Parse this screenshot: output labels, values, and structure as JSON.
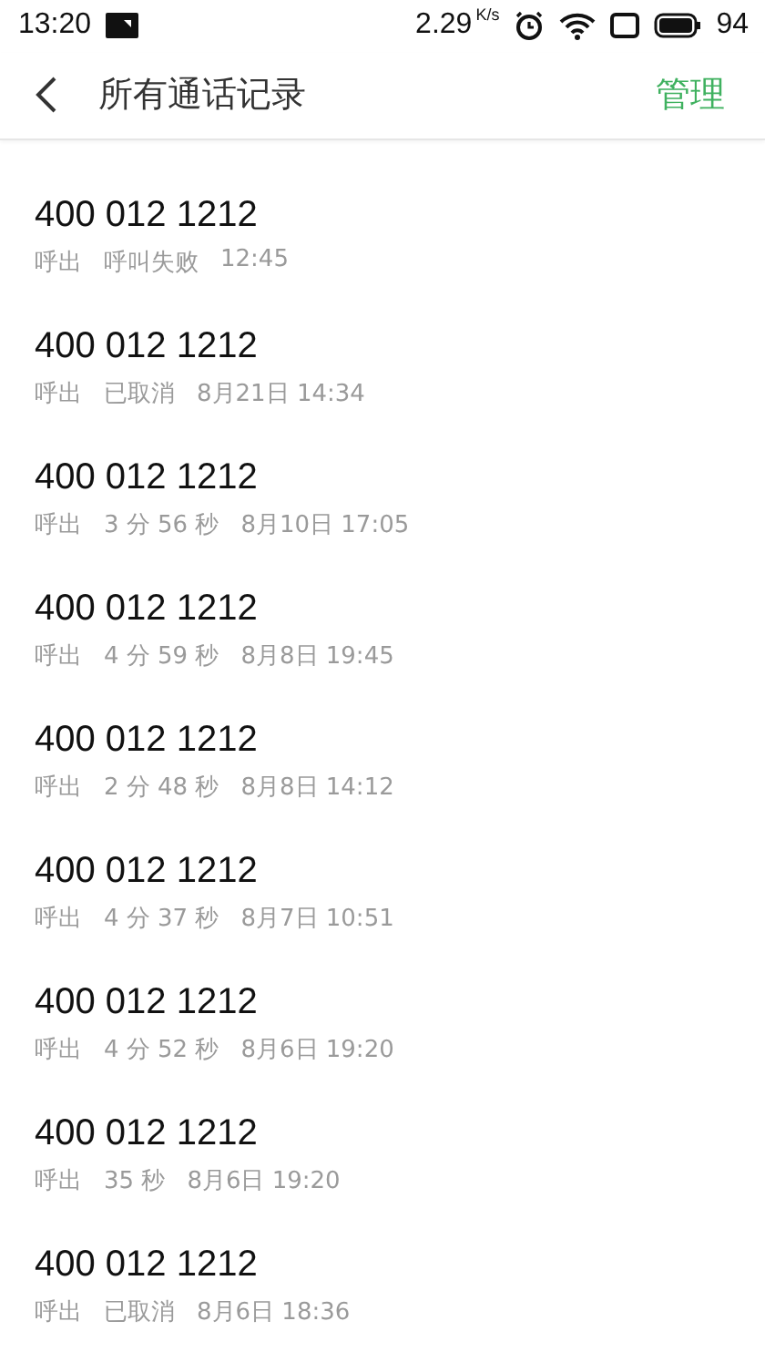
{
  "status_bar": {
    "time": "13:20",
    "speed": "2.29",
    "speed_unit": "K/s",
    "battery": "94"
  },
  "header": {
    "title": "所有通话记录",
    "action": "管理"
  },
  "calls": [
    {
      "number": "400 012 1212",
      "type": "呼出",
      "result": "呼叫失败",
      "time": "12:45"
    },
    {
      "number": "400 012 1212",
      "type": "呼出",
      "result": "已取消",
      "time": "8月21日 14:34"
    },
    {
      "number": "400 012 1212",
      "type": "呼出",
      "result": "3 分 56 秒",
      "time": "8月10日 17:05"
    },
    {
      "number": "400 012 1212",
      "type": "呼出",
      "result": "4 分 59 秒",
      "time": "8月8日 19:45"
    },
    {
      "number": "400 012 1212",
      "type": "呼出",
      "result": "2 分 48 秒",
      "time": "8月8日 14:12"
    },
    {
      "number": "400 012 1212",
      "type": "呼出",
      "result": "4 分 37 秒",
      "time": "8月7日 10:51"
    },
    {
      "number": "400 012 1212",
      "type": "呼出",
      "result": "4 分 52 秒",
      "time": "8月6日 19:20"
    },
    {
      "number": "400 012 1212",
      "type": "呼出",
      "result": "35 秒",
      "time": "8月6日 19:20"
    },
    {
      "number": "400 012 1212",
      "type": "呼出",
      "result": "已取消",
      "time": "8月6日 18:36"
    }
  ]
}
